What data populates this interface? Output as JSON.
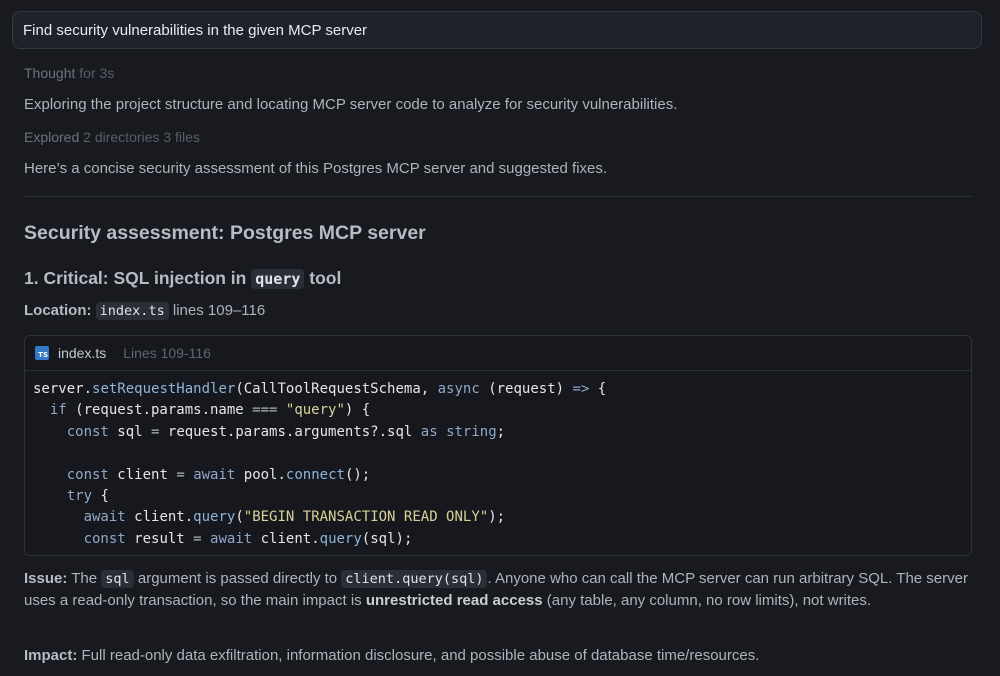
{
  "prompt": "Find security vulnerabilities in the given MCP server",
  "thought": {
    "label": "Thought",
    "duration": "for 3s"
  },
  "exploring_text": "Exploring the project structure and locating MCP server code to analyze for security vulnerabilities.",
  "explored": {
    "label": "Explored",
    "detail": "2 directories 3 files"
  },
  "summary_text": "Here’s a concise security assessment of this Postgres MCP server and suggested fixes.",
  "heading": "Security assessment: Postgres MCP server",
  "finding": {
    "title_prefix": "1. Critical: SQL injection in",
    "title_code": "query",
    "title_suffix": "tool",
    "location_label": "Location:",
    "location_file": "index.ts",
    "location_lines": "lines 109–116"
  },
  "code_block": {
    "icon_text": "TS",
    "filename": "index.ts",
    "lines_label": "Lines 109-116",
    "lines": [
      [
        [
          "server.",
          ""
        ],
        [
          "setRequestHandler",
          "fn"
        ],
        [
          "(CallToolRequestSchema, ",
          ""
        ],
        [
          "async",
          "kw"
        ],
        [
          " (request) ",
          ""
        ],
        [
          "=>",
          "kw"
        ],
        [
          " {",
          ""
        ]
      ],
      [
        [
          "  ",
          ""
        ],
        [
          "if",
          "kw"
        ],
        [
          " (request.params.name ",
          ""
        ],
        [
          "===",
          "op"
        ],
        [
          " ",
          ""
        ],
        [
          "\"query\"",
          "str"
        ],
        [
          ") {",
          ""
        ]
      ],
      [
        [
          "    ",
          ""
        ],
        [
          "const",
          "kw"
        ],
        [
          " sql ",
          ""
        ],
        [
          "=",
          "op"
        ],
        [
          " request.params.arguments?.sql ",
          ""
        ],
        [
          "as",
          "kw"
        ],
        [
          " ",
          ""
        ],
        [
          "string",
          "kw"
        ],
        [
          ";",
          ""
        ]
      ],
      [
        [
          "",
          ""
        ]
      ],
      [
        [
          "    ",
          ""
        ],
        [
          "const",
          "kw"
        ],
        [
          " client ",
          ""
        ],
        [
          "=",
          "op"
        ],
        [
          " ",
          ""
        ],
        [
          "await",
          "kw"
        ],
        [
          " pool.",
          ""
        ],
        [
          "connect",
          "fn"
        ],
        [
          "();",
          ""
        ]
      ],
      [
        [
          "    ",
          ""
        ],
        [
          "try",
          "kw"
        ],
        [
          " {",
          ""
        ]
      ],
      [
        [
          "      ",
          ""
        ],
        [
          "await",
          "kw"
        ],
        [
          " client.",
          ""
        ],
        [
          "query",
          "fn"
        ],
        [
          "(",
          ""
        ],
        [
          "\"BEGIN TRANSACTION READ ONLY\"",
          "str"
        ],
        [
          ");",
          ""
        ]
      ],
      [
        [
          "      ",
          ""
        ],
        [
          "const",
          "kw"
        ],
        [
          " result ",
          ""
        ],
        [
          "=",
          "op"
        ],
        [
          " ",
          ""
        ],
        [
          "await",
          "kw"
        ],
        [
          " client.",
          ""
        ],
        [
          "query",
          "fn"
        ],
        [
          "(sql);",
          ""
        ]
      ]
    ]
  },
  "issue": {
    "label": "Issue:",
    "t1": "The",
    "code1": "sql",
    "t2": "argument is passed directly to",
    "code2": "client.query(sql)",
    "t3": ". Anyone who can call the MCP server can run arbitrary SQL. The server uses a read-only transaction, so the main impact is",
    "strong": "unrestricted read access",
    "t4": "(any table, any column, no row limits), not writes."
  },
  "impact": {
    "label": "Impact:",
    "text": "Full read-only data exfiltration, information disclosure, and possible abuse of database time/resources."
  }
}
